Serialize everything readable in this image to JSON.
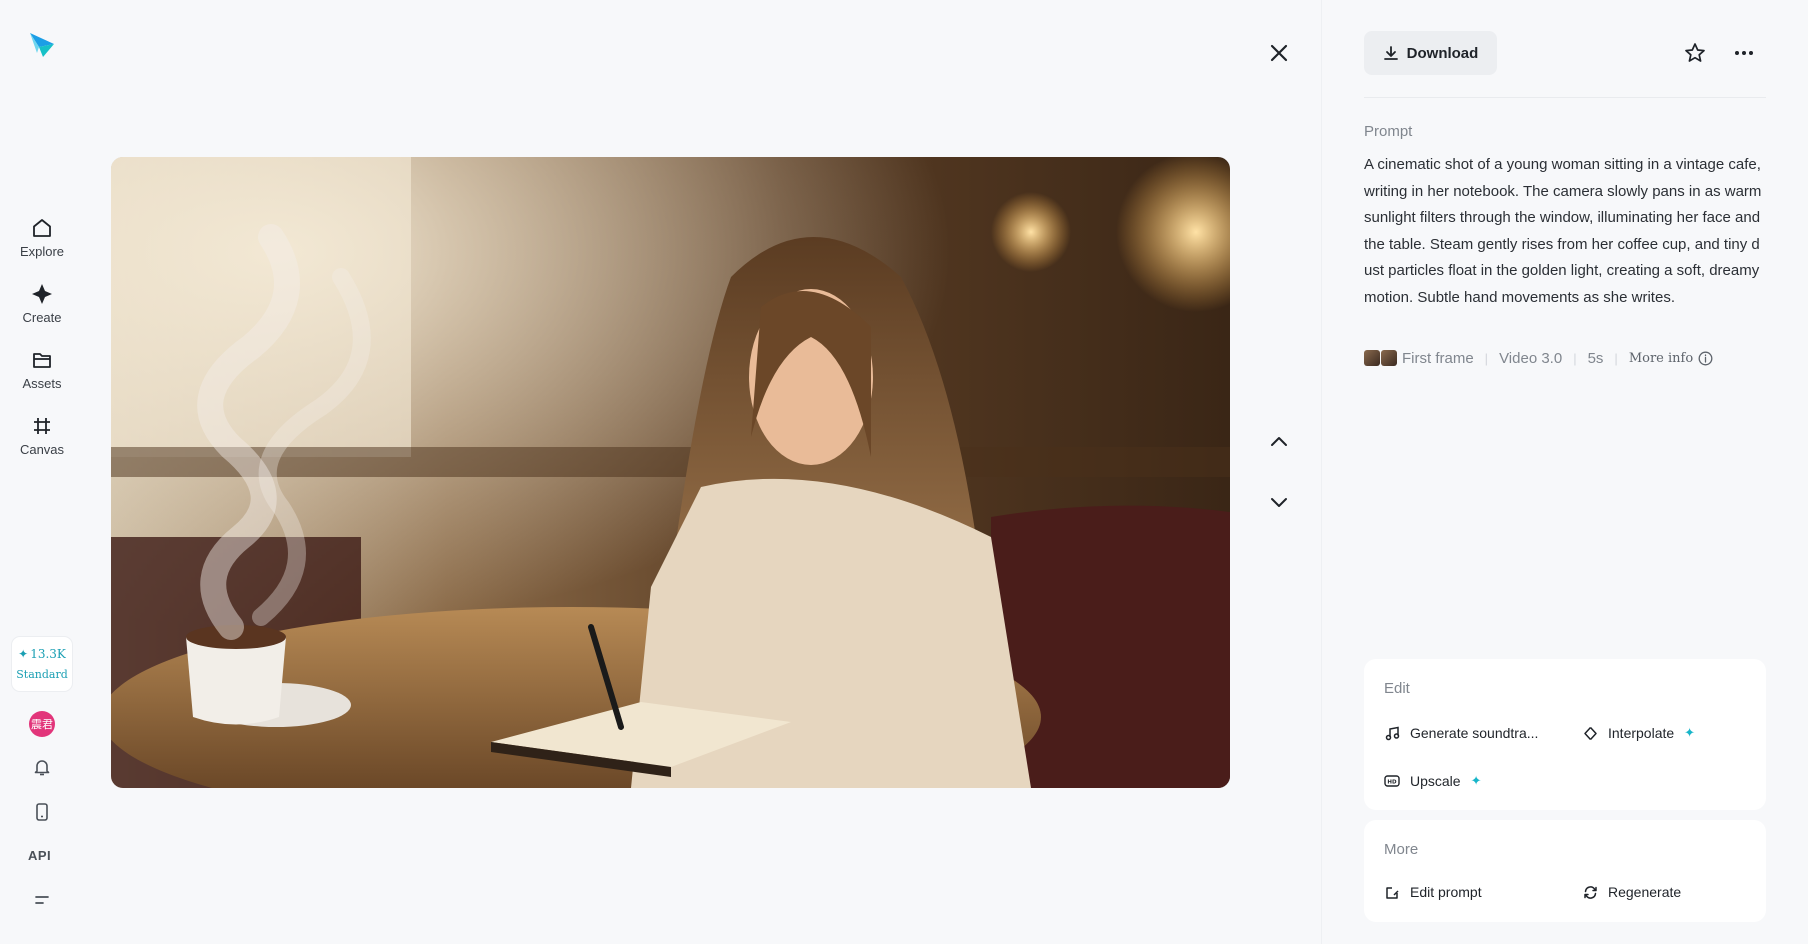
{
  "sidebar": {
    "items": [
      {
        "label": "Explore",
        "icon": "home-icon"
      },
      {
        "label": "Create",
        "icon": "sparkle-icon"
      },
      {
        "label": "Assets",
        "icon": "folder-icon"
      },
      {
        "label": "Canvas",
        "icon": "canvas-icon"
      }
    ],
    "credits": {
      "amount": "13.3K",
      "tier": "Standard"
    },
    "avatar_text": "震君",
    "api_label": "API"
  },
  "toolbar": {
    "download_label": "Download"
  },
  "prompt": {
    "title": "Prompt",
    "text": "A cinematic shot of a young woman sitting in a vintage cafe, writing in her notebook. The camera slowly pans in as warm sunlight filters through the window, illuminating her face and the table. Steam gently rises from her coffee cup, and tiny dust particles float in the golden light, creating a soft, dreamy motion. Subtle hand movements as she writes."
  },
  "meta": {
    "reference": "First frame",
    "model": "Video 3.0",
    "duration": "5s",
    "more_info": "More info"
  },
  "edit": {
    "title": "Edit",
    "actions": [
      {
        "label": "Generate soundtra...",
        "icon": "music-note-icon",
        "premium": false
      },
      {
        "label": "Interpolate",
        "icon": "interpolate-icon",
        "premium": true
      },
      {
        "label": "Upscale",
        "icon": "hd-icon",
        "premium": true
      }
    ]
  },
  "more": {
    "title": "More",
    "actions": [
      {
        "label": "Edit prompt",
        "icon": "edit-icon"
      },
      {
        "label": "Regenerate",
        "icon": "refresh-icon"
      }
    ]
  },
  "colors": {
    "accent": "#17b5c9",
    "avatar": "#e2357a",
    "background": "#f7f8fa"
  }
}
